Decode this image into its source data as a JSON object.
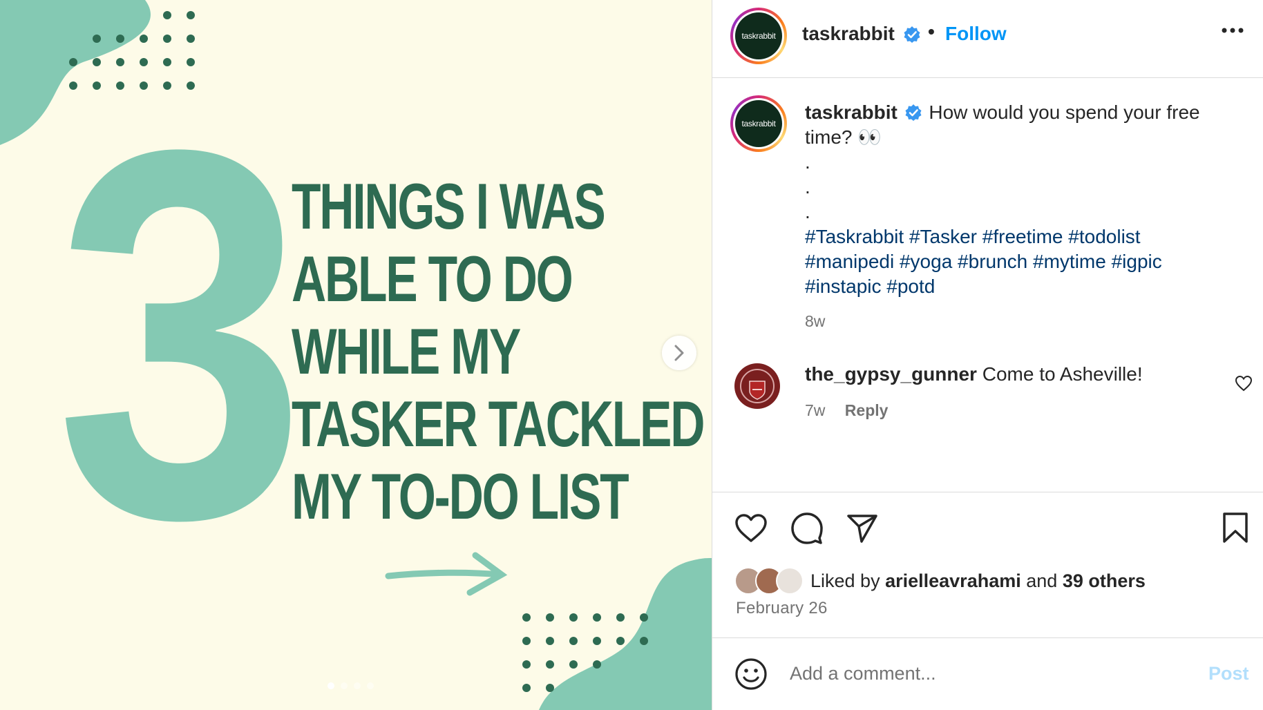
{
  "image": {
    "big_number": "3",
    "headline_lines": [
      "THINGS I WAS",
      "ABLE TO DO",
      "WHILE MY",
      "TASKER TACKLED",
      "MY TO-DO LIST"
    ],
    "colors": {
      "background": "#fdfbe8",
      "mint": "#84c9b3",
      "dark_green": "#2e6b52"
    },
    "carousel_total": 4,
    "carousel_active": 1
  },
  "header": {
    "avatar_text": "taskrabbit",
    "username": "taskrabbit",
    "separator": "•",
    "follow_label": "Follow"
  },
  "caption": {
    "username": "taskrabbit",
    "text_line1": "How would you spend your free",
    "text_line2": "time? 👀",
    "dots": [
      ".",
      ".",
      "."
    ],
    "hashtags_line1": "#Taskrabbit #Tasker #freetime #todolist",
    "hashtags_line2": "#manipedi #yoga #brunch #mytime #igpic",
    "hashtags_line3": "#instapic #potd",
    "time": "8w"
  },
  "comment": {
    "username": "the_gypsy_gunner",
    "text": "Come to Asheville!",
    "time": "7w",
    "reply_label": "Reply"
  },
  "likes": {
    "prefix": "Liked by",
    "user": "arielleavrahami",
    "middle": "and",
    "others": "39 others",
    "date": "February 26"
  },
  "add_comment": {
    "placeholder": "Add a comment...",
    "post_label": "Post"
  }
}
